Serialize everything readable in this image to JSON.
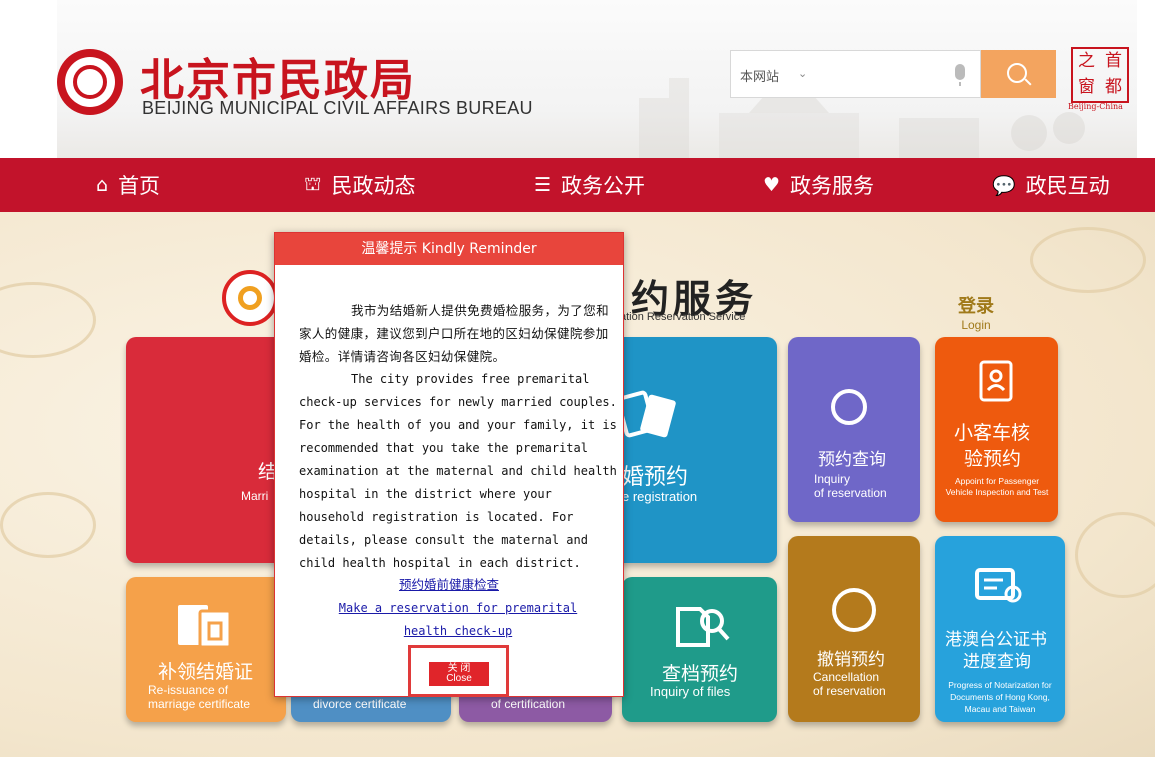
{
  "header": {
    "org_name_cn": "北京市民政局",
    "org_name_en": "BEIJING MUNICIPAL CIVIL AFFAIRS BUREAU",
    "search_scope": "本网站",
    "capital_seal": [
      "之",
      "首",
      "窗",
      "都"
    ],
    "capital_en": "Beijing-China"
  },
  "nav": {
    "items": [
      {
        "label": "首页",
        "icon": "home-icon"
      },
      {
        "label": "民政动态",
        "icon": "building-icon"
      },
      {
        "label": "政务公开",
        "icon": "document-stack-icon"
      },
      {
        "label": "政务服务",
        "icon": "heart-icon"
      },
      {
        "label": "政民互动",
        "icon": "chat-icon"
      }
    ]
  },
  "service": {
    "title_cn": "约服务",
    "title_en": "ation Reservation Service",
    "login_cn": "登录",
    "login_en": "Login"
  },
  "tiles": {
    "marriage_cn": "结",
    "marriage_en": "Marri",
    "divorce_cn": "婚预约",
    "divorce_en": "e registration",
    "inquiry_cn": "预约查询",
    "inquiry_en1": "Inquiry",
    "inquiry_en2": "of reservation",
    "vehicle_cn1": "小客车核",
    "vehicle_cn2": "验预约",
    "vehicle_en": "Appoint for Passenger Vehicle Inspection and Test",
    "reissue_cn": "补领结婚证",
    "reissue_en1": "Re-issuance of",
    "reissue_en2": "marriage certificate",
    "divorce_cert_en": "divorce certificate",
    "certification_en": "of certification",
    "files_cn": "查档预约",
    "files_en": "Inquiry of files",
    "cancel_cn": "撤销预约",
    "cancel_en1": "Cancellation",
    "cancel_en2": "of reservation",
    "hmt_cn1": "港澳台公证书",
    "hmt_cn2": "进度查询",
    "hmt_en": "Progress of Notarization for Documents of Hong Kong, Macau and Taiwan"
  },
  "modal": {
    "title": "温馨提示 Kindly Reminder",
    "para_cn": "我市为结婚新人提供免费婚检服务，为了您和家人的健康，建议您到户口所在地的区妇幼保健院参加婚检。详情请咨询各区妇幼保健院。",
    "para_en": "The city provides free premarital check-up services for newly married couples. For the health of you and your family, it is recommended that you take the premarital examination at the maternal and child health hospital in the district where your household registration is located. For details, please consult the maternal and child health hospital in each district.",
    "link_cn": "预约婚前健康检查",
    "link_en": "Make a reservation for premarital health check-up",
    "close_cn": "关 闭",
    "close_en": "Close"
  },
  "colors": {
    "nav_red": "#c2132b",
    "modal_red": "#e8453c",
    "search_orange": "#f3a45f"
  }
}
